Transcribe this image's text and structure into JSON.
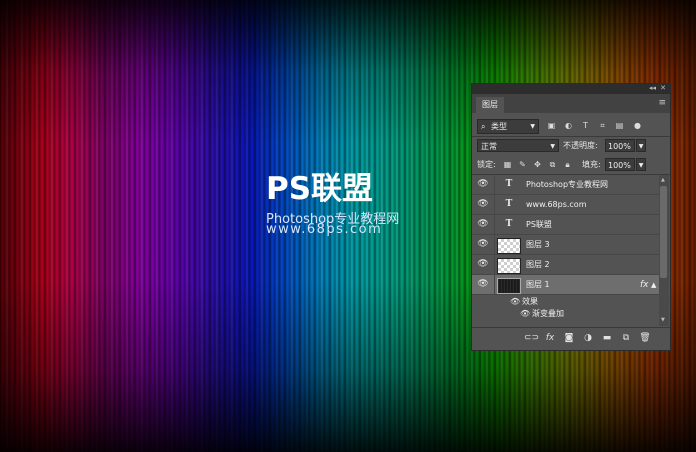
{
  "canvas": {
    "title": "PS联盟",
    "subtitle": "Photoshop专业教程网",
    "url": "www.68ps.com"
  },
  "panel": {
    "tab_label": "图层",
    "collapse_icon": "double-chevron-left-icon",
    "close_icon": "close-icon",
    "menu_icon": "hamburger-menu-icon",
    "filter": {
      "search_glyph": "⌕",
      "value": "类型",
      "icons": [
        "image-filter-icon",
        "adjustment-filter-icon",
        "type-filter-icon",
        "shape-filter-icon",
        "smart-object-filter-icon",
        "filter-toggle-icon"
      ]
    },
    "blend": {
      "mode": "正常",
      "opacity_label": "不透明度:",
      "opacity_value": "100%"
    },
    "lock": {
      "label": "锁定:",
      "icons": [
        "lock-transparent-icon",
        "lock-image-icon",
        "lock-position-icon",
        "lock-artboard-icon",
        "lock-all-icon"
      ],
      "fill_label": "填充:",
      "fill_value": "100%"
    },
    "layers": [
      {
        "name": "Photoshop专业教程网",
        "kind": "text"
      },
      {
        "name": "www.68ps.com",
        "kind": "text"
      },
      {
        "name": "PS联盟",
        "kind": "text"
      },
      {
        "name": "图层 3",
        "kind": "pixel"
      },
      {
        "name": "图层 2",
        "kind": "pixel"
      },
      {
        "name": "图层 1",
        "kind": "pixel-dark",
        "selected": true,
        "fx": "fx"
      }
    ],
    "effects_label": "效果",
    "effect_item": "渐变叠加",
    "bottom_icons": [
      "link-layers-icon",
      "fx-icon",
      "add-mask-icon",
      "adjustment-layer-icon",
      "new-group-icon",
      "new-layer-icon",
      "delete-icon"
    ],
    "bottom_fx_label": "fx"
  }
}
